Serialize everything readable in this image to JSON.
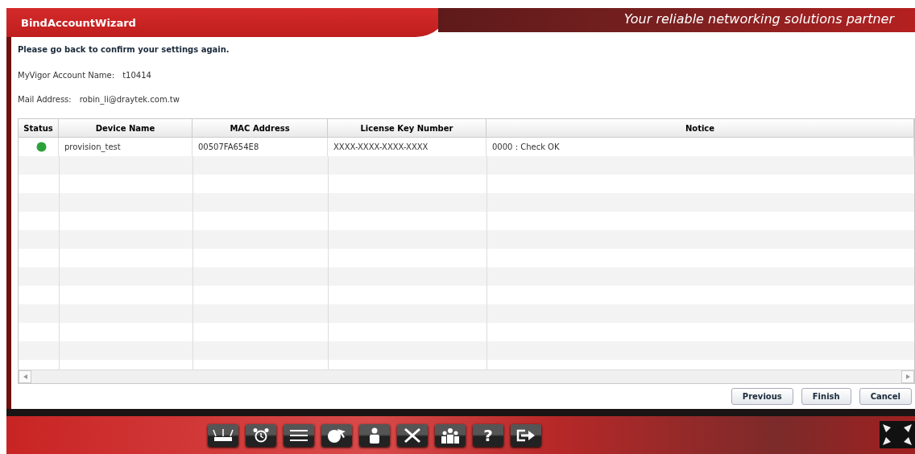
{
  "window": {
    "title": "BindAccountWizard",
    "slogan": "Your reliable networking solutions partner"
  },
  "message": "Please go back to confirm your settings again.",
  "fields": [
    {
      "label": "MyVigor Account Name:",
      "value": "t10414"
    },
    {
      "label": "Mail Address:",
      "value": "robin_li@draytek.com.tw"
    }
  ],
  "table": {
    "columns": [
      "Status",
      "Device Name",
      "MAC Address",
      "License Key Number",
      "Notice"
    ],
    "rows": [
      {
        "color": "#2aa23a",
        "device_name": "provision_test",
        "mac_address": "00507FA654E8",
        "license_key": "XXXX-XXXX-XXXX-XXXX",
        "notice": "0000 : Check OK"
      }
    ]
  },
  "buttons": [
    "Previous",
    "Finish",
    "Cancel"
  ],
  "dock": [
    {
      "kind": "router"
    },
    {
      "kind": "alarm"
    },
    {
      "kind": "list"
    },
    {
      "kind": "acs"
    },
    {
      "kind": "user"
    },
    {
      "kind": "tools"
    },
    {
      "kind": "group"
    },
    {
      "kind": "help",
      "label": "?"
    },
    {
      "kind": "logout"
    }
  ]
}
